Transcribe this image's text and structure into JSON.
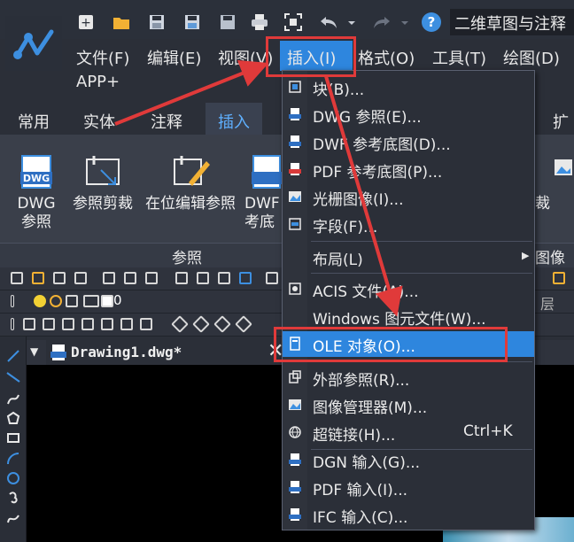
{
  "title_bar": {
    "document_title": "二维草图与注释",
    "quick_access": [
      "new-icon",
      "open-icon",
      "save-icon",
      "saveas-icon",
      "print-icon",
      "zoom-extents-icon",
      "undo-icon",
      "redo-icon",
      "help-icon"
    ],
    "help_glyph": "?"
  },
  "menu_bar": {
    "file": "文件(F)",
    "edit": "编辑(E)",
    "view": "视图(V)",
    "insert": "插入(I)",
    "format": "格式(O)",
    "tools": "工具(T)",
    "draw": "绘图(D)",
    "app_plus": "APP+"
  },
  "ribbon_tabs": {
    "common": "常用",
    "solid": "实体",
    "annotate": "注释",
    "insert": "插入",
    "extend": "扩"
  },
  "ribbon": {
    "dwg_ref": "DWG\n参照",
    "dwg_icon_text": "DWG",
    "ref_clip": "参照剪裁",
    "edit_in_place": "在位编辑参照",
    "dwf_under": "DWF\n考底",
    "clip_partial": "裁",
    "panel_ref": "参照",
    "panel_image": "图像",
    "layer_value": "0",
    "layer_partial": "层"
  },
  "document_tab": {
    "name": "Drawing1.dwg*",
    "close": "✕"
  },
  "insert_menu": {
    "items": [
      {
        "label": "块(B)...",
        "icon": "block-icon"
      },
      {
        "label": "DWG 参照(E)...",
        "icon": "dwg-ref-icon"
      },
      {
        "label": "DWF 参考底图(D)...",
        "icon": "dwf-underlay-icon"
      },
      {
        "label": "PDF 参考底图(P)...",
        "icon": "pdf-underlay-icon"
      },
      {
        "label": "光栅图像(I)...",
        "icon": "raster-image-icon"
      },
      {
        "label": "字段(F)...",
        "icon": "field-icon"
      },
      {
        "label": "布局(L)",
        "icon": ""
      },
      {
        "label": "ACIS 文件(A)...",
        "icon": "acis-icon"
      },
      {
        "label": "Windows 图元文件(W)...",
        "icon": ""
      },
      {
        "label": "OLE 对象(O)...",
        "icon": "ole-object-icon"
      },
      {
        "label": "外部参照(R)...",
        "icon": "xref-icon"
      },
      {
        "label": "图像管理器(M)...",
        "icon": "image-manager-icon"
      },
      {
        "label": "超链接(H)...",
        "icon": "hyperlink-icon",
        "shortcut": "Ctrl+K"
      },
      {
        "label": "DGN 输入(G)...",
        "icon": "dgn-import-icon"
      },
      {
        "label": "PDF 输入(I)...",
        "icon": "pdf-import-icon"
      },
      {
        "label": "IFC 输入(C)...",
        "icon": "ifc-import-icon"
      }
    ],
    "submenu_arrow": "▶"
  },
  "colors": {
    "highlight": "#2e86de",
    "annotation_red": "#e03a3a",
    "background": "#2b2f38"
  }
}
